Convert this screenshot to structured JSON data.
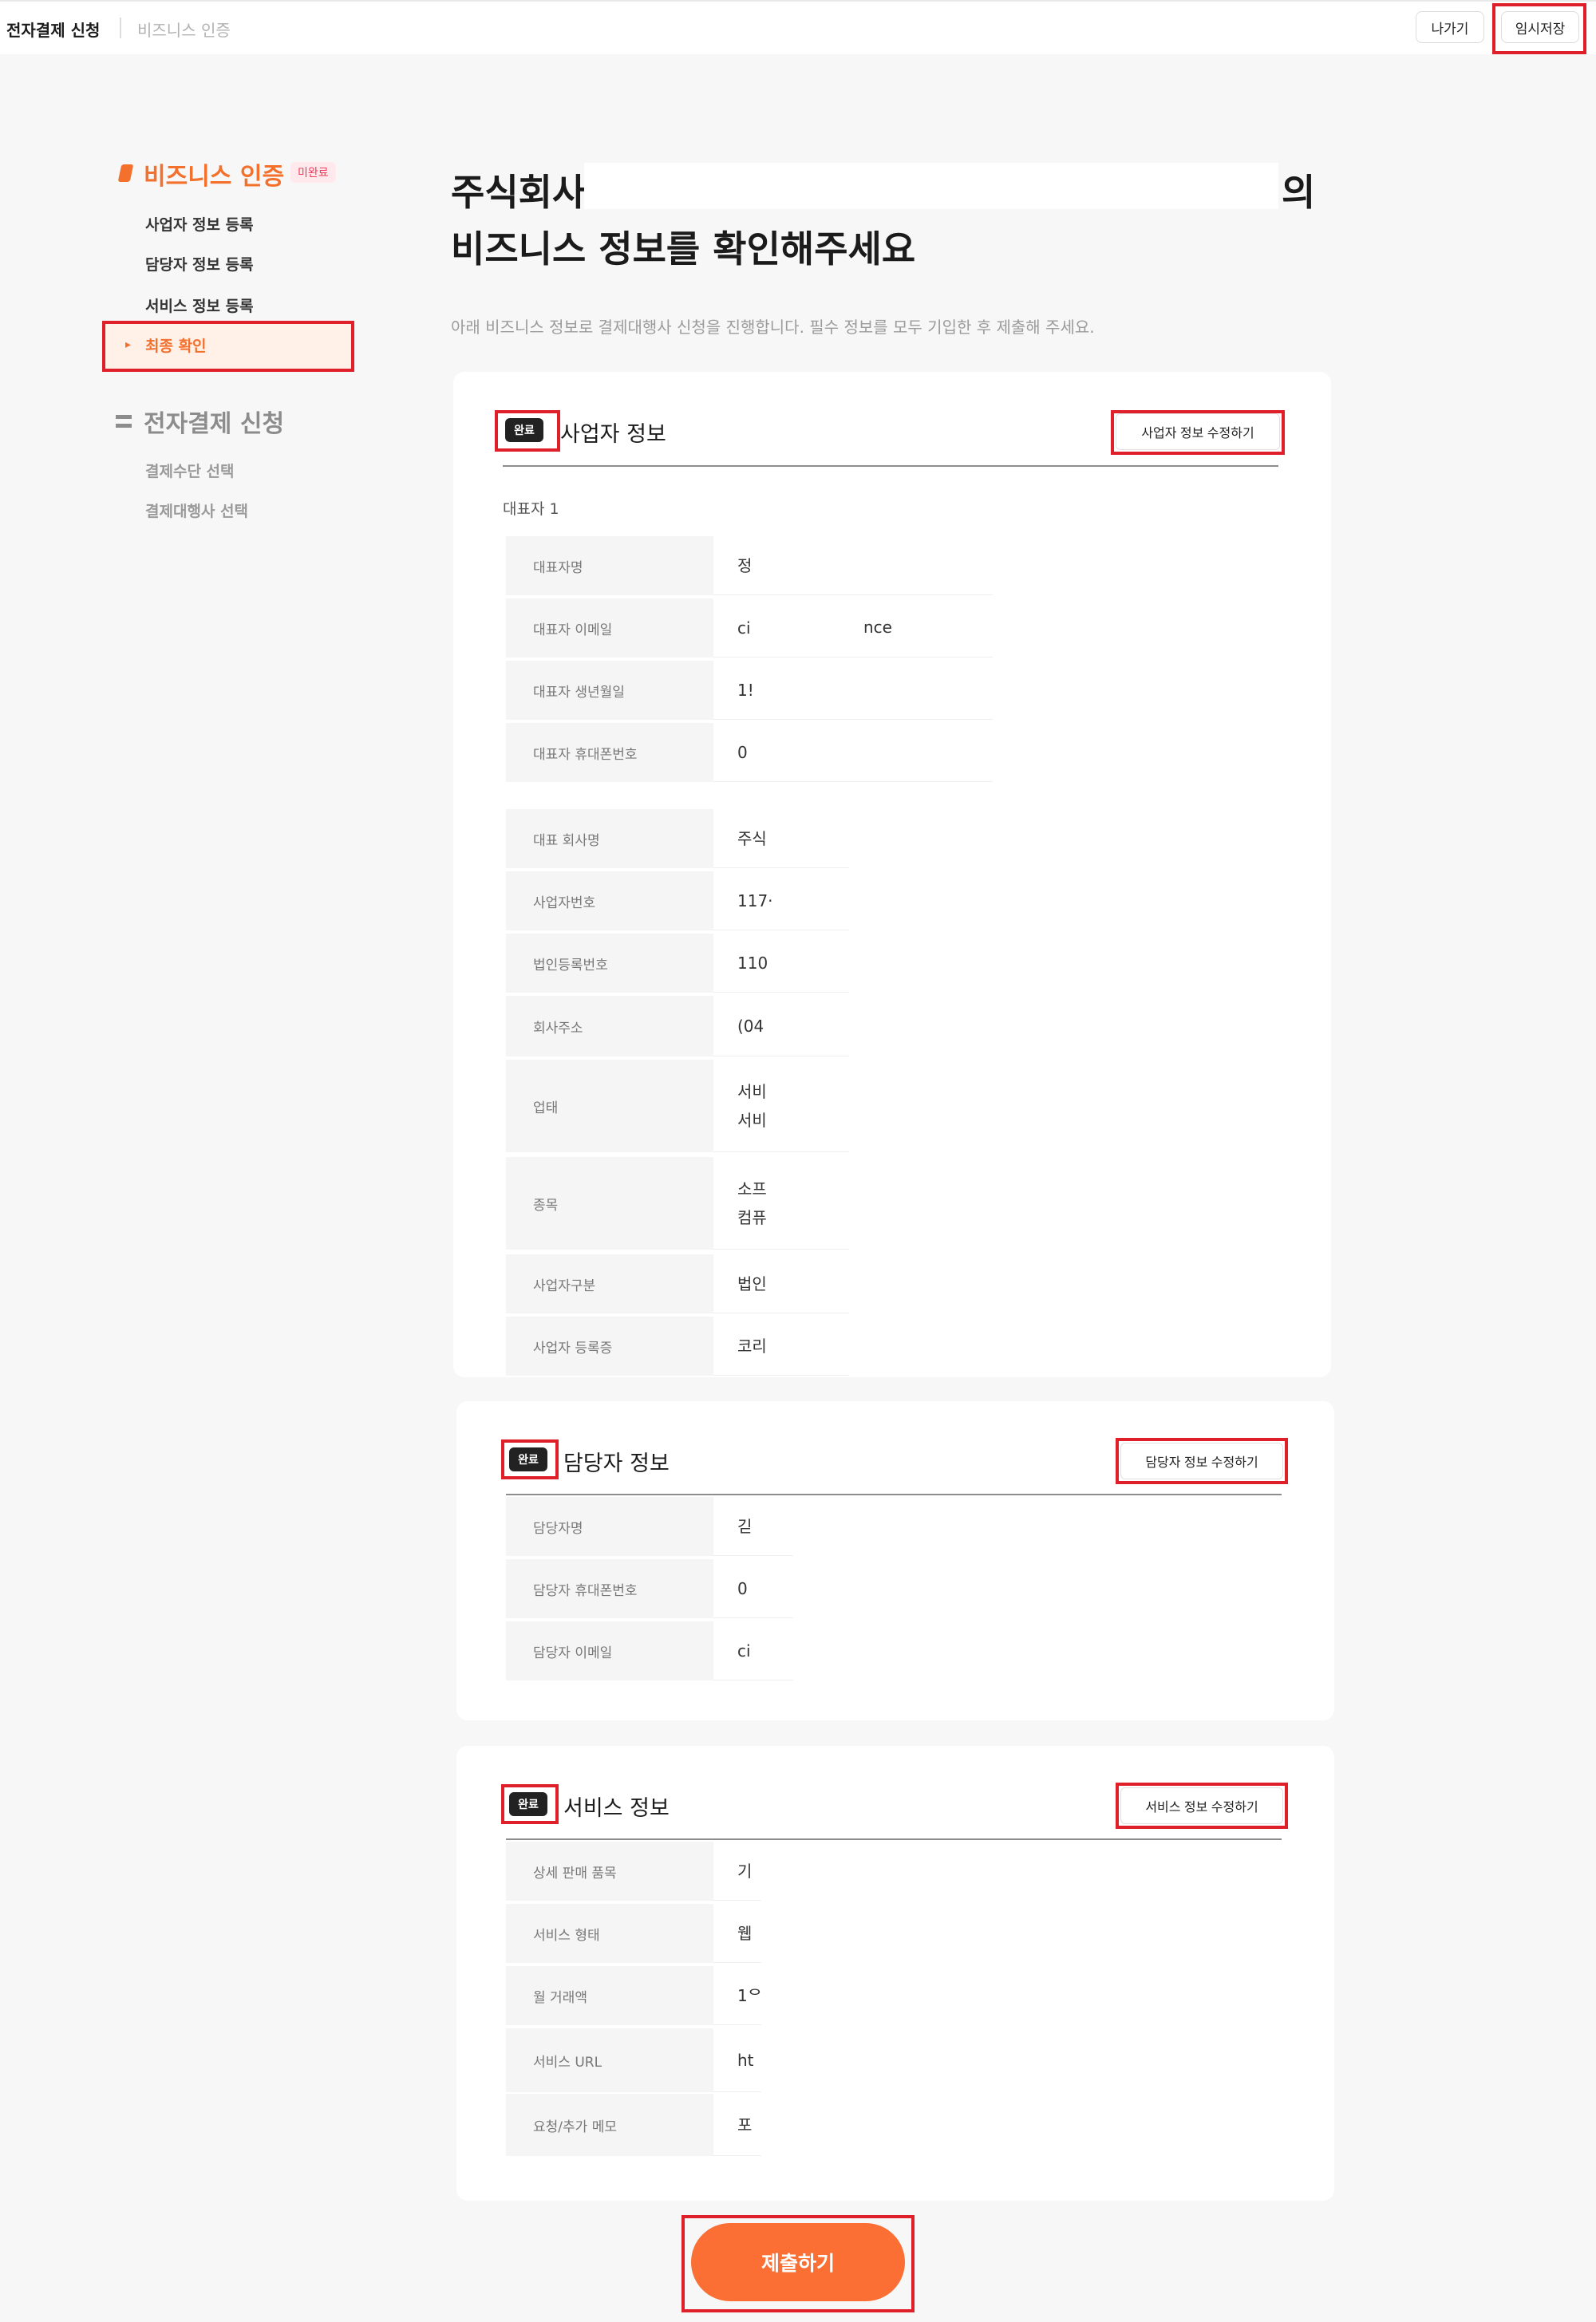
{
  "topbar": {
    "breadcrumb": [
      "전자결제 신청",
      "비즈니스 인증"
    ],
    "exit_label": "나가기",
    "temp_save_label": "임시저장"
  },
  "sidebar": {
    "section1_title": "비즈니스 인증",
    "section1_badge": "미완료",
    "section1_items": [
      "사업자 정보 등록",
      "담당자 정보 등록",
      "서비스 정보 등록",
      "최종 확인"
    ],
    "active_arrow": "▸",
    "section2_title": "전자결제 신청",
    "section2_items": [
      "결제수단 선택",
      "결제대행사 선택"
    ]
  },
  "main": {
    "title_prefix": "주식회사",
    "title_suffix": "의",
    "title_line2": "비즈니스 정보를 확인해주세요",
    "subtitle": "아래 비즈니스 정보로 결제대행사 신청을 진행합니다. 필수 정보를 모두 기입한 후 제출해 주세요."
  },
  "business": {
    "badge": "완료",
    "title": "사업자 정보",
    "edit_label": "사업자 정보 수정하기",
    "rep_label": "대표자 1",
    "rep_rows": [
      {
        "label": "대표자명",
        "value": "정"
      },
      {
        "label": "대표자 이메일",
        "value": "ci",
        "value_tail": "nce"
      },
      {
        "label": "대표자 생년월일",
        "value": "1!"
      },
      {
        "label": "대표자 휴대폰번호",
        "value": "0"
      }
    ],
    "company_rows": [
      {
        "label": "대표 회사명",
        "value": "주식"
      },
      {
        "label": "사업자번호",
        "value": "117·"
      },
      {
        "label": "법인등록번호",
        "value": "110"
      },
      {
        "label": "회사주소",
        "value": "(04"
      },
      {
        "label": "업태",
        "value": "서비\n서비"
      },
      {
        "label": "종목",
        "value": "소프\n컴퓨"
      },
      {
        "label": "사업자구분",
        "value": "법인"
      },
      {
        "label": "사업자 등록증",
        "value": "코리"
      }
    ]
  },
  "manager": {
    "badge": "완료",
    "title": "담당자 정보",
    "edit_label": "담당자 정보 수정하기",
    "rows": [
      {
        "label": "담당자명",
        "value": "긷"
      },
      {
        "label": "담당자 휴대폰번호",
        "value": "0"
      },
      {
        "label": "담당자 이메일",
        "value": "ci"
      }
    ]
  },
  "service": {
    "badge": "완료",
    "title": "서비스 정보",
    "edit_label": "서비스 정보 수정하기",
    "rows": [
      {
        "label": "상세 판매 품목",
        "value": "기"
      },
      {
        "label": "서비스 형태",
        "value": "웹"
      },
      {
        "label": "월 거래액",
        "value": "1ᄋ"
      },
      {
        "label": "서비스 URL",
        "value": "ht"
      },
      {
        "label": "요청/추가 메모",
        "value": "포"
      }
    ]
  },
  "submit_label": "제출하기",
  "colors": {
    "accent": "#fb6f35",
    "highlight_box": "#df1f2a"
  }
}
